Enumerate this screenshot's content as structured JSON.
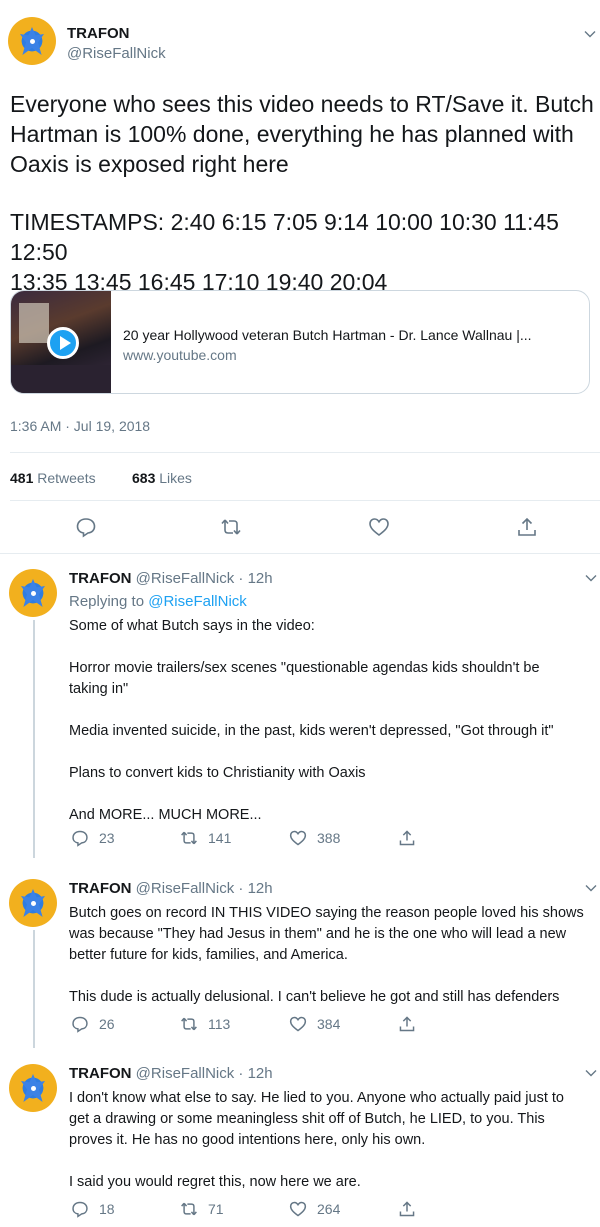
{
  "main_tweet": {
    "name": "TRAFON",
    "handle": "@RiseFallNick",
    "text_lines": [
      "Everyone who sees this video needs to RT/Save it. Butch",
      "Hartman is 100% done, everything he has planned with",
      "Oaxis is exposed right here",
      "TIMESTAMPS: 2:40 6:15 7:05  9:14 10:00 10:30 11:45 12:50",
      "13:35 13:45 16:45 17:10 19:40 20:04"
    ],
    "card": {
      "title": "20 year Hollywood veteran Butch Hartman - Dr. Lance Wallnau |...",
      "domain": "www.youtube.com"
    },
    "timestamp": "1:36 AM · Jul 19, 2018",
    "retweets_count": "481",
    "retweets_label": "Retweets",
    "likes_count": "683",
    "likes_label": "Likes",
    "accent_color": "#1da1f2"
  },
  "replies": [
    {
      "name": "TRAFON",
      "handle_time": "@RiseFallNick · 12h",
      "replying_prefix": "Replying to",
      "replying_to": "@RiseFallNick",
      "lines": [
        "Some of what Butch says in the video:",
        "Horror movie trailers/sex scenes \"questionable agendas kids shouldn't be",
        "taking in\"",
        "Media invented suicide, in the past, kids weren't depressed, \"Got through it\"",
        "Plans to convert kids to Christianity with Oaxis",
        "And MORE... MUCH MORE..."
      ],
      "replies": "23",
      "retweets": "141",
      "likes": "388"
    },
    {
      "name": "TRAFON",
      "handle_time": "@RiseFallNick · 12h",
      "lines": [
        "Butch goes on record IN THIS VIDEO saying the reason people loved his shows",
        "was because \"They had Jesus in them\" and he is the one who will lead a new",
        "better future for kids, families, and America.",
        "This dude is actually delusional. I can't believe he got and still has defenders"
      ],
      "replies": "26",
      "retweets": "113",
      "likes": "384"
    },
    {
      "name": "TRAFON",
      "handle_time": "@RiseFallNick · 12h",
      "lines": [
        "I don't know what else to say. He lied to you. Anyone who actually paid just to",
        "get a drawing or some meaningless shit off of Butch, he LIED, to you. This",
        "proves it. He has no good intentions here, only his own.",
        "I said you would regret this, now here we are."
      ],
      "replies": "18",
      "retweets": "71",
      "likes": "264"
    }
  ]
}
